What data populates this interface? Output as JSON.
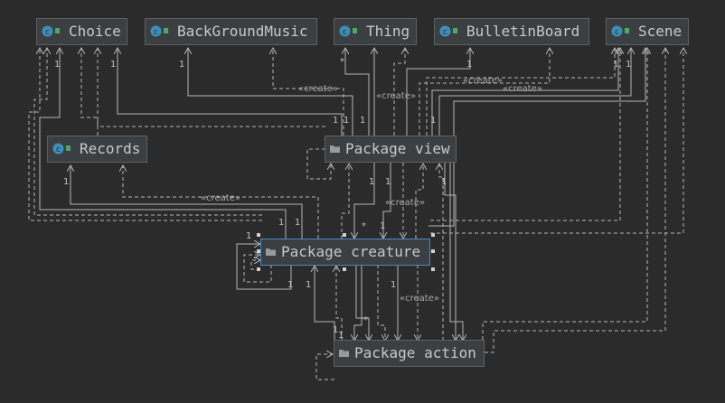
{
  "nodes": {
    "choice": {
      "label": "Choice",
      "kind": "class"
    },
    "bgmusic": {
      "label": "BackGroundMusic",
      "kind": "class"
    },
    "thing": {
      "label": "Thing",
      "kind": "class"
    },
    "bulletin": {
      "label": "BulletinBoard",
      "kind": "class"
    },
    "scene": {
      "label": "Scene",
      "kind": "class"
    },
    "records": {
      "label": "Records",
      "kind": "class"
    },
    "pview": {
      "label": "Package view",
      "kind": "package"
    },
    "pcreature": {
      "label": "Package creature",
      "kind": "package"
    },
    "paction": {
      "label": "Package action",
      "kind": "package"
    }
  },
  "stereotype": "«create»",
  "multiplicities": {
    "one": "1",
    "many": "*"
  },
  "colors": {
    "background": "#2b2b2b",
    "node_fill": "#3c3f41",
    "node_border": "#5e6164",
    "selection": "#4a88c7",
    "line": "#b4b4b4",
    "text": "#c8c8c8",
    "class_icon": "#3d8fb8",
    "package_icon": "#9a9a9a"
  }
}
